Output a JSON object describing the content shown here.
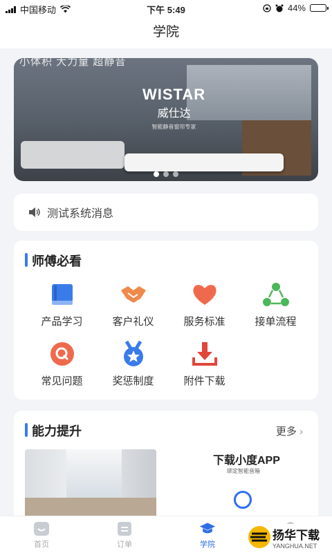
{
  "status_bar": {
    "carrier": "中国移动",
    "time": "下午 5:49",
    "battery": "44%",
    "battery_level": 0.44
  },
  "nav": {
    "title": "学院"
  },
  "banner": {
    "slogan": "小体积 大力量 超静音",
    "brand_en": "WISTAR",
    "brand_cn": "威仕达",
    "brand_sub": "智能静音窗帘专家",
    "dots": 3,
    "active_dot": 0
  },
  "notice": {
    "icon": "speaker-icon",
    "text": "测试系统消息"
  },
  "master": {
    "title": "师傅必看",
    "accent": "#3a7bea",
    "items": [
      {
        "label": "产品学习",
        "icon": "book-icon",
        "color": "#3a7bea"
      },
      {
        "label": "客户礼仪",
        "icon": "handshake-icon",
        "color": "#f0894a"
      },
      {
        "label": "服务标准",
        "icon": "heart-icon",
        "color": "#ef6a4d"
      },
      {
        "label": "接单流程",
        "icon": "flow-icon",
        "color": "#4cb85b"
      },
      {
        "label": "常见问题",
        "icon": "question-icon",
        "color": "#ef6a4d"
      },
      {
        "label": "奖惩制度",
        "icon": "medal-icon",
        "color": "#3a7bea"
      },
      {
        "label": "附件下载",
        "icon": "download-icon",
        "color": "#e0463a"
      }
    ]
  },
  "ability": {
    "title": "能力提升",
    "more": "更多",
    "card2_title": "下载小度APP",
    "card2_sub": "绑定智能音箱"
  },
  "tabbar": {
    "active_color": "#2f6fe6",
    "items": [
      {
        "label": "首页",
        "icon": "home-icon"
      },
      {
        "label": "订单",
        "icon": "order-icon"
      },
      {
        "label": "学院",
        "icon": "graduation-cap-icon"
      },
      {
        "label": "",
        "icon": "profile-icon"
      }
    ]
  },
  "watermark": {
    "cn": "扬华下载",
    "en": "YANGHUA.NET"
  }
}
